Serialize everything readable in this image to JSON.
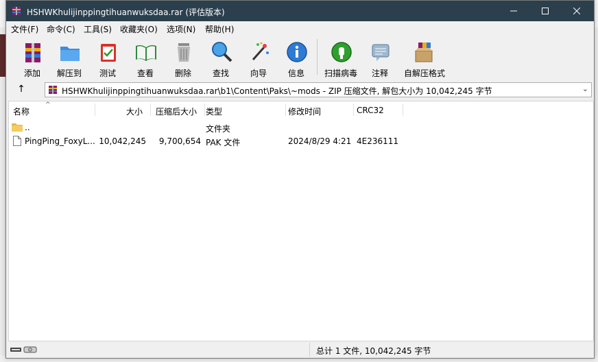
{
  "window": {
    "title": "HSHWKhulijinppingtihuanwuksdaa.rar (评估版本)"
  },
  "menu": [
    "文件(F)",
    "命令(C)",
    "工具(S)",
    "收藏夹(O)",
    "选项(N)",
    "帮助(H)"
  ],
  "toolbar": {
    "add": "添加",
    "extract": "解压到",
    "test": "测试",
    "view": "查看",
    "delete": "删除",
    "find": "查找",
    "wizard": "向导",
    "info": "信息",
    "virus": "扫描病毒",
    "comment": "注释",
    "sfx": "自解压格式"
  },
  "address": {
    "path": "HSHWKhulijinppingtihuanwuksdaa.rar\\b1\\Content\\Paks\\~mods - ZIP 压缩文件, 解包大小为 10,042,245 字节"
  },
  "columns": {
    "name": "名称",
    "size": "大小",
    "packed": "压缩后大小",
    "type": "类型",
    "modified": "修改时间",
    "crc": "CRC32"
  },
  "files": [
    {
      "name": "..",
      "size": "",
      "packed": "",
      "type": "文件夹",
      "modified": "",
      "crc": "",
      "icon": "folder-icon"
    },
    {
      "name": "PingPing_FoxyL...",
      "size": "10,042,245",
      "packed": "9,700,654",
      "type": "PAK 文件",
      "modified": "2024/8/29 4:21",
      "crc": "4E236111",
      "icon": "file-icon"
    }
  ],
  "status": {
    "text": "总计 1 文件, 10,042,245 字节"
  },
  "colors": {
    "titlebar": "#2b3f4d",
    "window_bg": "#f0f0f0"
  }
}
